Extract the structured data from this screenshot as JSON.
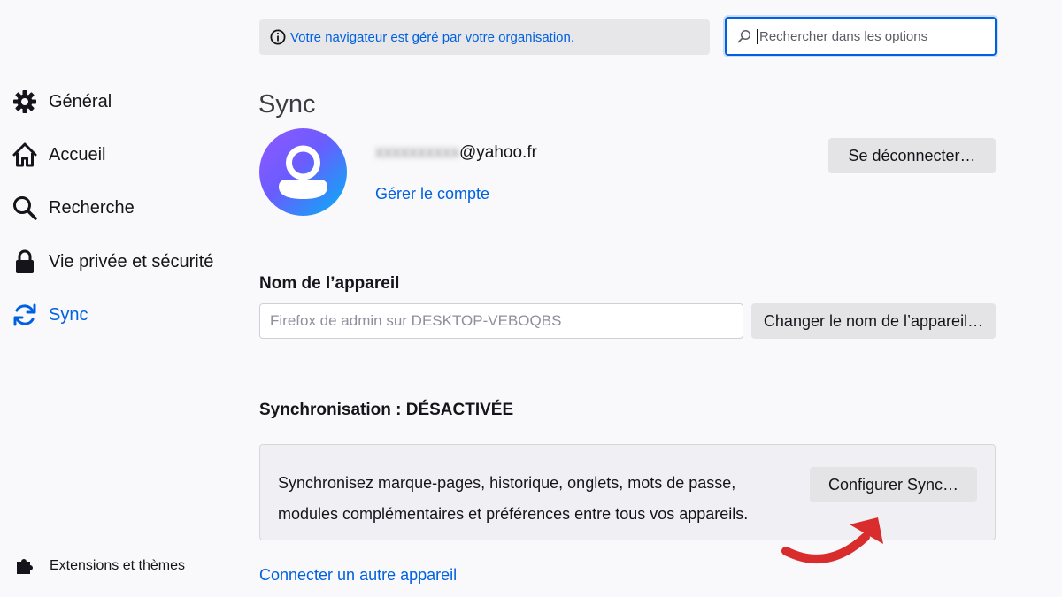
{
  "sidebar": {
    "items": [
      {
        "label": "Général",
        "icon": "gear-icon"
      },
      {
        "label": "Accueil",
        "icon": "home-icon"
      },
      {
        "label": "Recherche",
        "icon": "search-icon"
      },
      {
        "label": "Vie privée et sécurité",
        "icon": "lock-icon"
      },
      {
        "label": "Sync",
        "icon": "sync-icon",
        "active": true
      }
    ],
    "extensions_label": "Extensions et thèmes"
  },
  "policy_notice": {
    "text": "Votre navigateur est géré par votre organisation.",
    "icon": "info-icon"
  },
  "search": {
    "placeholder": "Rechercher dans les options",
    "value": ""
  },
  "sync_page": {
    "title": "Sync",
    "account": {
      "email_redacted_part": "xxxxxxxxxx",
      "email_domain": "@yahoo.fr",
      "manage_link": "Gérer le compte",
      "disconnect_button": "Se déconnecter…"
    },
    "device": {
      "heading": "Nom de l’appareil",
      "name_value": "Firefox de admin sur DESKTOP-VEBOQBS",
      "rename_button": "Changer le nom de l’appareil…"
    },
    "sync_status": {
      "heading": "Synchronisation : DÉSACTIVÉE",
      "description_line1": "Synchronisez marque-pages, historique, onglets, mots de passe,",
      "description_line2": "modules complémentaires et préférences entre tous vos appareils.",
      "configure_button": "Configurer Sync…"
    },
    "connect_device_link": "Connecter un autre appareil"
  },
  "colors": {
    "accent": "#0061e0",
    "annotation_arrow": "#d92d2d"
  }
}
